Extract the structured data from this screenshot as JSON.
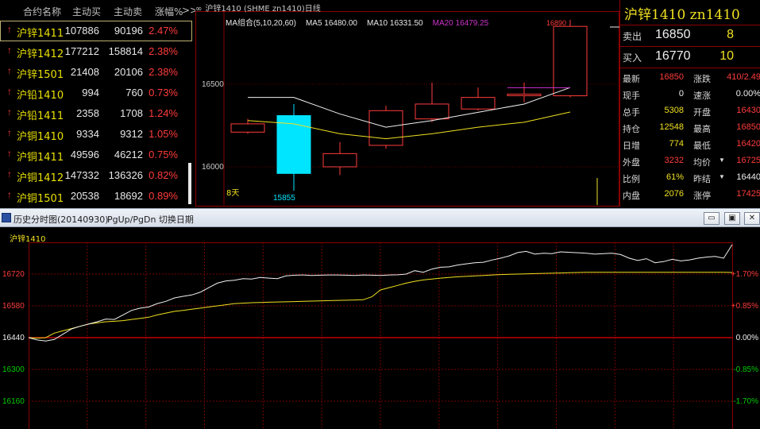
{
  "watchlist": {
    "headers": {
      "name": "合约名称",
      "buy": "主动买",
      "sell": "主动卖",
      "chg": "涨幅%",
      "more": ">>"
    },
    "rows": [
      {
        "name": "沪锌1411",
        "buy": "107886",
        "sell": "90196",
        "chg": "2.47%"
      },
      {
        "name": "沪锌1412",
        "buy": "177212",
        "sell": "158814",
        "chg": "2.38%"
      },
      {
        "name": "沪锌1501",
        "buy": "21408",
        "sell": "20106",
        "chg": "2.38%"
      },
      {
        "name": "沪铅1410",
        "buy": "994",
        "sell": "760",
        "chg": "0.73%"
      },
      {
        "name": "沪铅1411",
        "buy": "2358",
        "sell": "1708",
        "chg": "1.24%"
      },
      {
        "name": "沪铜1410",
        "buy": "9334",
        "sell": "9312",
        "chg": "1.05%"
      },
      {
        "name": "沪铜1411",
        "buy": "49596",
        "sell": "46212",
        "chg": "0.75%"
      },
      {
        "name": "沪铜1412",
        "buy": "147332",
        "sell": "136326",
        "chg": "0.82%"
      },
      {
        "name": "沪铜1501",
        "buy": "20538",
        "sell": "18692",
        "chg": "0.89%"
      }
    ],
    "selected_index": 0
  },
  "daily": {
    "title": "沪锌1410 (SHME zn1410)日线",
    "ma": [
      {
        "label": "MA组合(5,10,20,60)",
        "color": "#e8e8e8"
      },
      {
        "label": "MA5 16480.00",
        "color": "#e8e8e8"
      },
      {
        "label": "MA10 16331.50",
        "color": "#e8e8e8"
      },
      {
        "label": "MA20 16479.25",
        "color": "#cc33cc"
      }
    ],
    "y_labels": [
      "16500",
      "16000"
    ],
    "low_label": "15855",
    "high_label": "16890",
    "bottom_label": "8天",
    "colors": {
      "up": "#ff3b3b",
      "down": "#00e5ff",
      "ma5": "#f0f0f0",
      "ma10": "#f0e020",
      "ma20": "#cc33cc"
    },
    "candles": [
      {
        "o": 16210,
        "c": 16260,
        "h": 16290,
        "l": 16200
      },
      {
        "o": 16310,
        "c": 15960,
        "h": 16380,
        "l": 15855
      },
      {
        "o": 16000,
        "c": 16080,
        "h": 16150,
        "l": 15950
      },
      {
        "o": 16130,
        "c": 16340,
        "h": 16370,
        "l": 16110
      },
      {
        "o": 16290,
        "c": 16380,
        "h": 16510,
        "l": 16270
      },
      {
        "o": 16350,
        "c": 16420,
        "h": 16480,
        "l": 16340
      },
      {
        "o": 16440,
        "c": 16440,
        "h": 16510,
        "l": 16390
      },
      {
        "o": 16430,
        "c": 16850,
        "h": 16890,
        "l": 16420
      }
    ],
    "ma5": [
      16420,
      16420,
      16320,
      16240,
      16280,
      16330,
      16380,
      16480
    ],
    "ma10": [
      16280,
      16260,
      16200,
      16170,
      16200,
      16240,
      16270,
      16331.5
    ],
    "ma20": [
      16479.25,
      16479.25
    ]
  },
  "quote": {
    "title": "沪锌1410  zn1410",
    "sell": {
      "label": "卖出",
      "price": "16850",
      "vol": "8"
    },
    "buy": {
      "label": "买入",
      "price": "16770",
      "vol": "10"
    },
    "rows": [
      {
        "l1": "最新",
        "v1": "16850",
        "c1": "red",
        "l2": "涨跌",
        "v2": "410/2.49",
        "c2": "red"
      },
      {
        "l1": "现手",
        "v1": "0",
        "c1": "white",
        "l2": "速涨",
        "v2": "0.00%",
        "c2": "white"
      },
      {
        "l1": "总手",
        "v1": "5308",
        "c1": "yellow",
        "l2": "开盘",
        "v2": "16430",
        "c2": "red"
      },
      {
        "l1": "持仓",
        "v1": "12548",
        "c1": "yellow",
        "l2": "最高",
        "v2": "16850",
        "c2": "red"
      },
      {
        "l1": "日增",
        "v1": "774",
        "c1": "yellow",
        "l2": "最低",
        "v2": "16420",
        "c2": "red"
      },
      {
        "l1": "外盘",
        "v1": "3232",
        "c1": "red",
        "l2": "均价",
        "v2": "16725",
        "c2": "red",
        "drop2": true
      },
      {
        "l1": "比例",
        "v1": "61%",
        "c1": "yellow",
        "l2": "昨结",
        "v2": "16440",
        "c2": "white",
        "drop2": true
      },
      {
        "l1": "内盘",
        "v1": "2076",
        "c1": "yellow",
        "l2": "涨停",
        "v2": "17425",
        "c2": "red"
      }
    ]
  },
  "history": {
    "title": "历史分时图(20140930)",
    "keys": "PgUp/PgDn  切换日期",
    "buttons": {
      "min": "▭",
      "max": "▣",
      "close": "✕"
    },
    "symbol": "沪锌1410",
    "y_left": [
      {
        "v": 16720,
        "color": "#ff3b3b"
      },
      {
        "v": 16580,
        "color": "#ff3b3b"
      },
      {
        "v": 16440,
        "color": "#f0f0f0"
      },
      {
        "v": 16300,
        "color": "#00cc00"
      },
      {
        "v": 16160,
        "color": "#00cc00"
      }
    ],
    "y_right": [
      {
        "t": "1.70%",
        "color": "#ff3b3b"
      },
      {
        "t": "0.85%",
        "color": "#ff3b3b"
      },
      {
        "t": "0.00%",
        "color": "#f0f0f0"
      },
      {
        "t": "-0.85%",
        "color": "#00cc00"
      },
      {
        "t": "-1.70%",
        "color": "#00cc00"
      }
    ],
    "ylim": [
      16160,
      16720
    ],
    "price": [
      16440,
      16430,
      16425,
      16432,
      16455,
      16478,
      16490,
      16500,
      16510,
      16522,
      16520,
      16540,
      16560,
      16570,
      16575,
      16590,
      16600,
      16615,
      16622,
      16628,
      16640,
      16660,
      16680,
      16690,
      16693,
      16700,
      16698,
      16705,
      16702,
      16700,
      16712,
      16715,
      16716,
      16714,
      16715,
      16716,
      16716,
      16715,
      16714,
      16716,
      16715,
      16714,
      16716,
      16717,
      16720,
      16735,
      16728,
      16742,
      16750,
      16752,
      16760,
      16765,
      16770,
      16772,
      16782,
      16790,
      16800,
      16815,
      16820,
      16808,
      16812,
      16810,
      16818,
      16816,
      16814,
      16812,
      16808,
      16810,
      16812,
      16806,
      16790,
      16780,
      16788,
      16770,
      16775,
      16785,
      16778,
      16782,
      16790,
      16795,
      16798,
      16790,
      16850
    ],
    "avg": [
      16440,
      16438,
      16440,
      16460,
      16470,
      16480,
      16490,
      16500,
      16505,
      16510,
      16512,
      16515,
      16520,
      16525,
      16530,
      16540,
      16548,
      16556,
      16560,
      16565,
      16570,
      16575,
      16580,
      16585,
      16590,
      16592,
      16594,
      16595,
      16596,
      16597,
      16598,
      16599,
      16600,
      16601,
      16602,
      16603,
      16604,
      16605,
      16606,
      16607,
      16620,
      16650,
      16660,
      16670,
      16680,
      16688,
      16694,
      16698,
      16702,
      16705,
      16708,
      16710,
      16712,
      16714,
      16716,
      16718,
      16719,
      16720,
      16721,
      16722,
      16723,
      16724,
      16725,
      16726,
      16727,
      16728,
      16728,
      16728,
      16728,
      16728,
      16728,
      16728,
      16728,
      16728,
      16728,
      16728,
      16728,
      16728,
      16728,
      16728,
      16728,
      16728,
      16727
    ]
  }
}
